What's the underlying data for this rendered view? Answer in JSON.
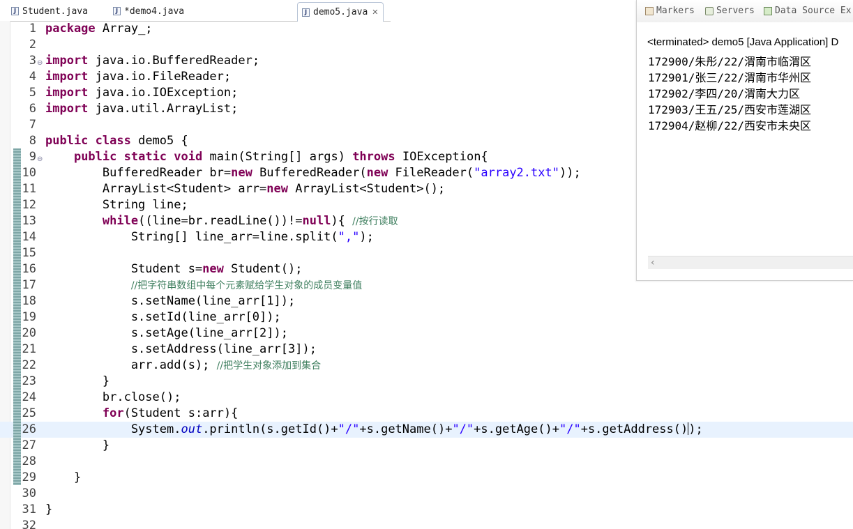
{
  "editor_tabs": [
    {
      "label": "Student.java",
      "active": false
    },
    {
      "label": "*demo4.java",
      "active": false
    },
    {
      "label": "demo5.java",
      "active": true
    }
  ],
  "console": {
    "tabs": [
      "Markers",
      "Servers",
      "Data Source Ex"
    ],
    "header": "<terminated> demo5 [Java Application] D",
    "output": [
      "172900/朱彤/22/渭南市临渭区",
      "172901/张三/22/渭南市华州区",
      "172902/李四/20/渭南大力区",
      "172903/王五/25/西安市莲湖区",
      "172904/赵柳/22/西安市未央区"
    ]
  },
  "code_lines": [
    {
      "n": "1",
      "text": "package Array_;"
    },
    {
      "n": "2",
      "text": ""
    },
    {
      "n": "3",
      "text": "import java.io.BufferedReader;"
    },
    {
      "n": "4",
      "text": "import java.io.FileReader;"
    },
    {
      "n": "5",
      "text": "import java.io.IOException;"
    },
    {
      "n": "6",
      "text": "import java.util.ArrayList;"
    },
    {
      "n": "7",
      "text": ""
    },
    {
      "n": "8",
      "text": "public class demo5 {"
    },
    {
      "n": "9",
      "text": "    public static void main(String[] args) throws IOException{"
    },
    {
      "n": "10",
      "text": "        BufferedReader br=new BufferedReader(new FileReader(\"array2.txt\"));"
    },
    {
      "n": "11",
      "text": "        ArrayList<Student> arr=new ArrayList<Student>();"
    },
    {
      "n": "12",
      "text": "        String line;"
    },
    {
      "n": "13",
      "text": "        while((line=br.readLine())!=null){ //按行读取"
    },
    {
      "n": "14",
      "text": "            String[] line_arr=line.split(\",\");"
    },
    {
      "n": "15",
      "text": ""
    },
    {
      "n": "16",
      "text": "            Student s=new Student();"
    },
    {
      "n": "17",
      "text": "            //把字符串数组中每个元素赋给学生对象的成员变量值"
    },
    {
      "n": "18",
      "text": "            s.setName(line_arr[1]);"
    },
    {
      "n": "19",
      "text": "            s.setId(line_arr[0]);"
    },
    {
      "n": "20",
      "text": "            s.setAge(line_arr[2]);"
    },
    {
      "n": "21",
      "text": "            s.setAddress(line_arr[3]);"
    },
    {
      "n": "22",
      "text": "            arr.add(s); //把学生对象添加到集合"
    },
    {
      "n": "23",
      "text": "        }"
    },
    {
      "n": "24",
      "text": "        br.close();"
    },
    {
      "n": "25",
      "text": "        for(Student s:arr){"
    },
    {
      "n": "26",
      "text": "            System.out.println(s.getId()+\"/\"+s.getName()+\"/\"+s.getAge()+\"/\"+s.getAddress());"
    },
    {
      "n": "27",
      "text": "        }"
    },
    {
      "n": "28",
      "text": ""
    },
    {
      "n": "29",
      "text": "    }"
    },
    {
      "n": "30",
      "text": ""
    },
    {
      "n": "31",
      "text": "}"
    },
    {
      "n": "32",
      "text": ""
    }
  ],
  "current_line": "26",
  "fold_lines": [
    "3",
    "9"
  ]
}
